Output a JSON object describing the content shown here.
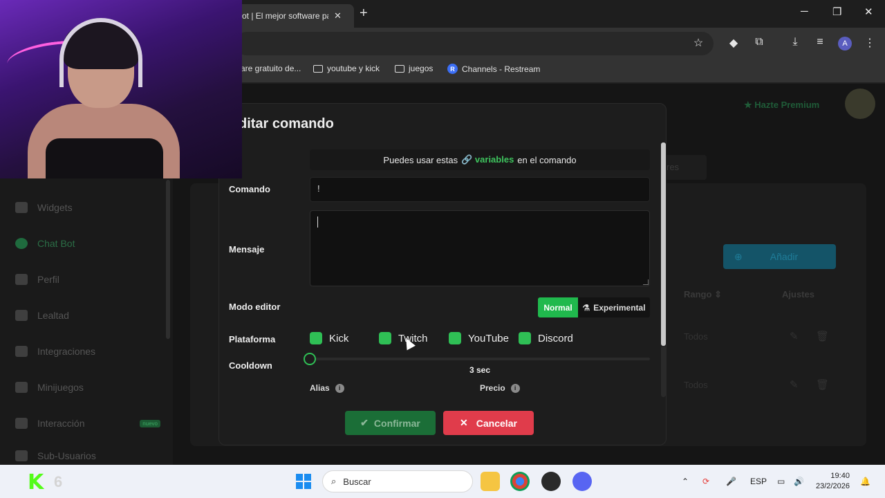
{
  "browser": {
    "tab_title": "ot | El mejor software par",
    "tab_close": "✕",
    "new_tab": "+",
    "window_controls": {
      "minimize": "─",
      "maximize": "❐",
      "close": "✕"
    },
    "profile_initial": "A",
    "bookmarks": [
      {
        "label": "are gratuito de..."
      },
      {
        "label": "youtube y kick"
      },
      {
        "label": "juegos"
      },
      {
        "label": "Channels - Restream",
        "badge": "R"
      }
    ]
  },
  "modal": {
    "title": "ditar comando",
    "variables_prefix": "Puedes usar estas",
    "variables_link": "variables",
    "variables_suffix": "en el comando",
    "fields": {
      "comando_label": "Comando",
      "comando_value": "!",
      "mensaje_label": "Mensaje",
      "mensaje_value": "",
      "modo_label": "Modo editor",
      "modo_normal": "Normal",
      "modo_experimental": "Experimental",
      "plataforma_label": "Plataforma",
      "platforms": [
        "Kick",
        "Twitch",
        "YouTube",
        "Discord"
      ],
      "cooldown_label": "Cooldown",
      "cooldown_value": "3 sec",
      "alias_label": "Alias",
      "precio_label": "Precio"
    },
    "confirm_label": "Confirmar",
    "cancel_label": "Cancelar"
  },
  "background": {
    "premium": "Hazte Premium",
    "add_button": "Añadir",
    "tab_partial": "res",
    "columns": {
      "rango": "Rango",
      "ajustes": "Ajustes"
    },
    "rows": [
      "Todos",
      "Todos"
    ],
    "sidebar": [
      {
        "label": "Widgets"
      },
      {
        "label": "Chat Bot",
        "active": true
      },
      {
        "label": "Perfil"
      },
      {
        "label": "Lealtad"
      },
      {
        "label": "Integraciones"
      },
      {
        "label": "Minijuegos"
      },
      {
        "label": "Interacción",
        "badge": "nuevo"
      },
      {
        "label": "Sub-Usuarios"
      }
    ]
  },
  "taskbar": {
    "k_logo": "K",
    "k_number": "6",
    "search_placeholder": "Buscar",
    "language": "ESP",
    "time": "19:40",
    "date": "23/2/2026"
  }
}
